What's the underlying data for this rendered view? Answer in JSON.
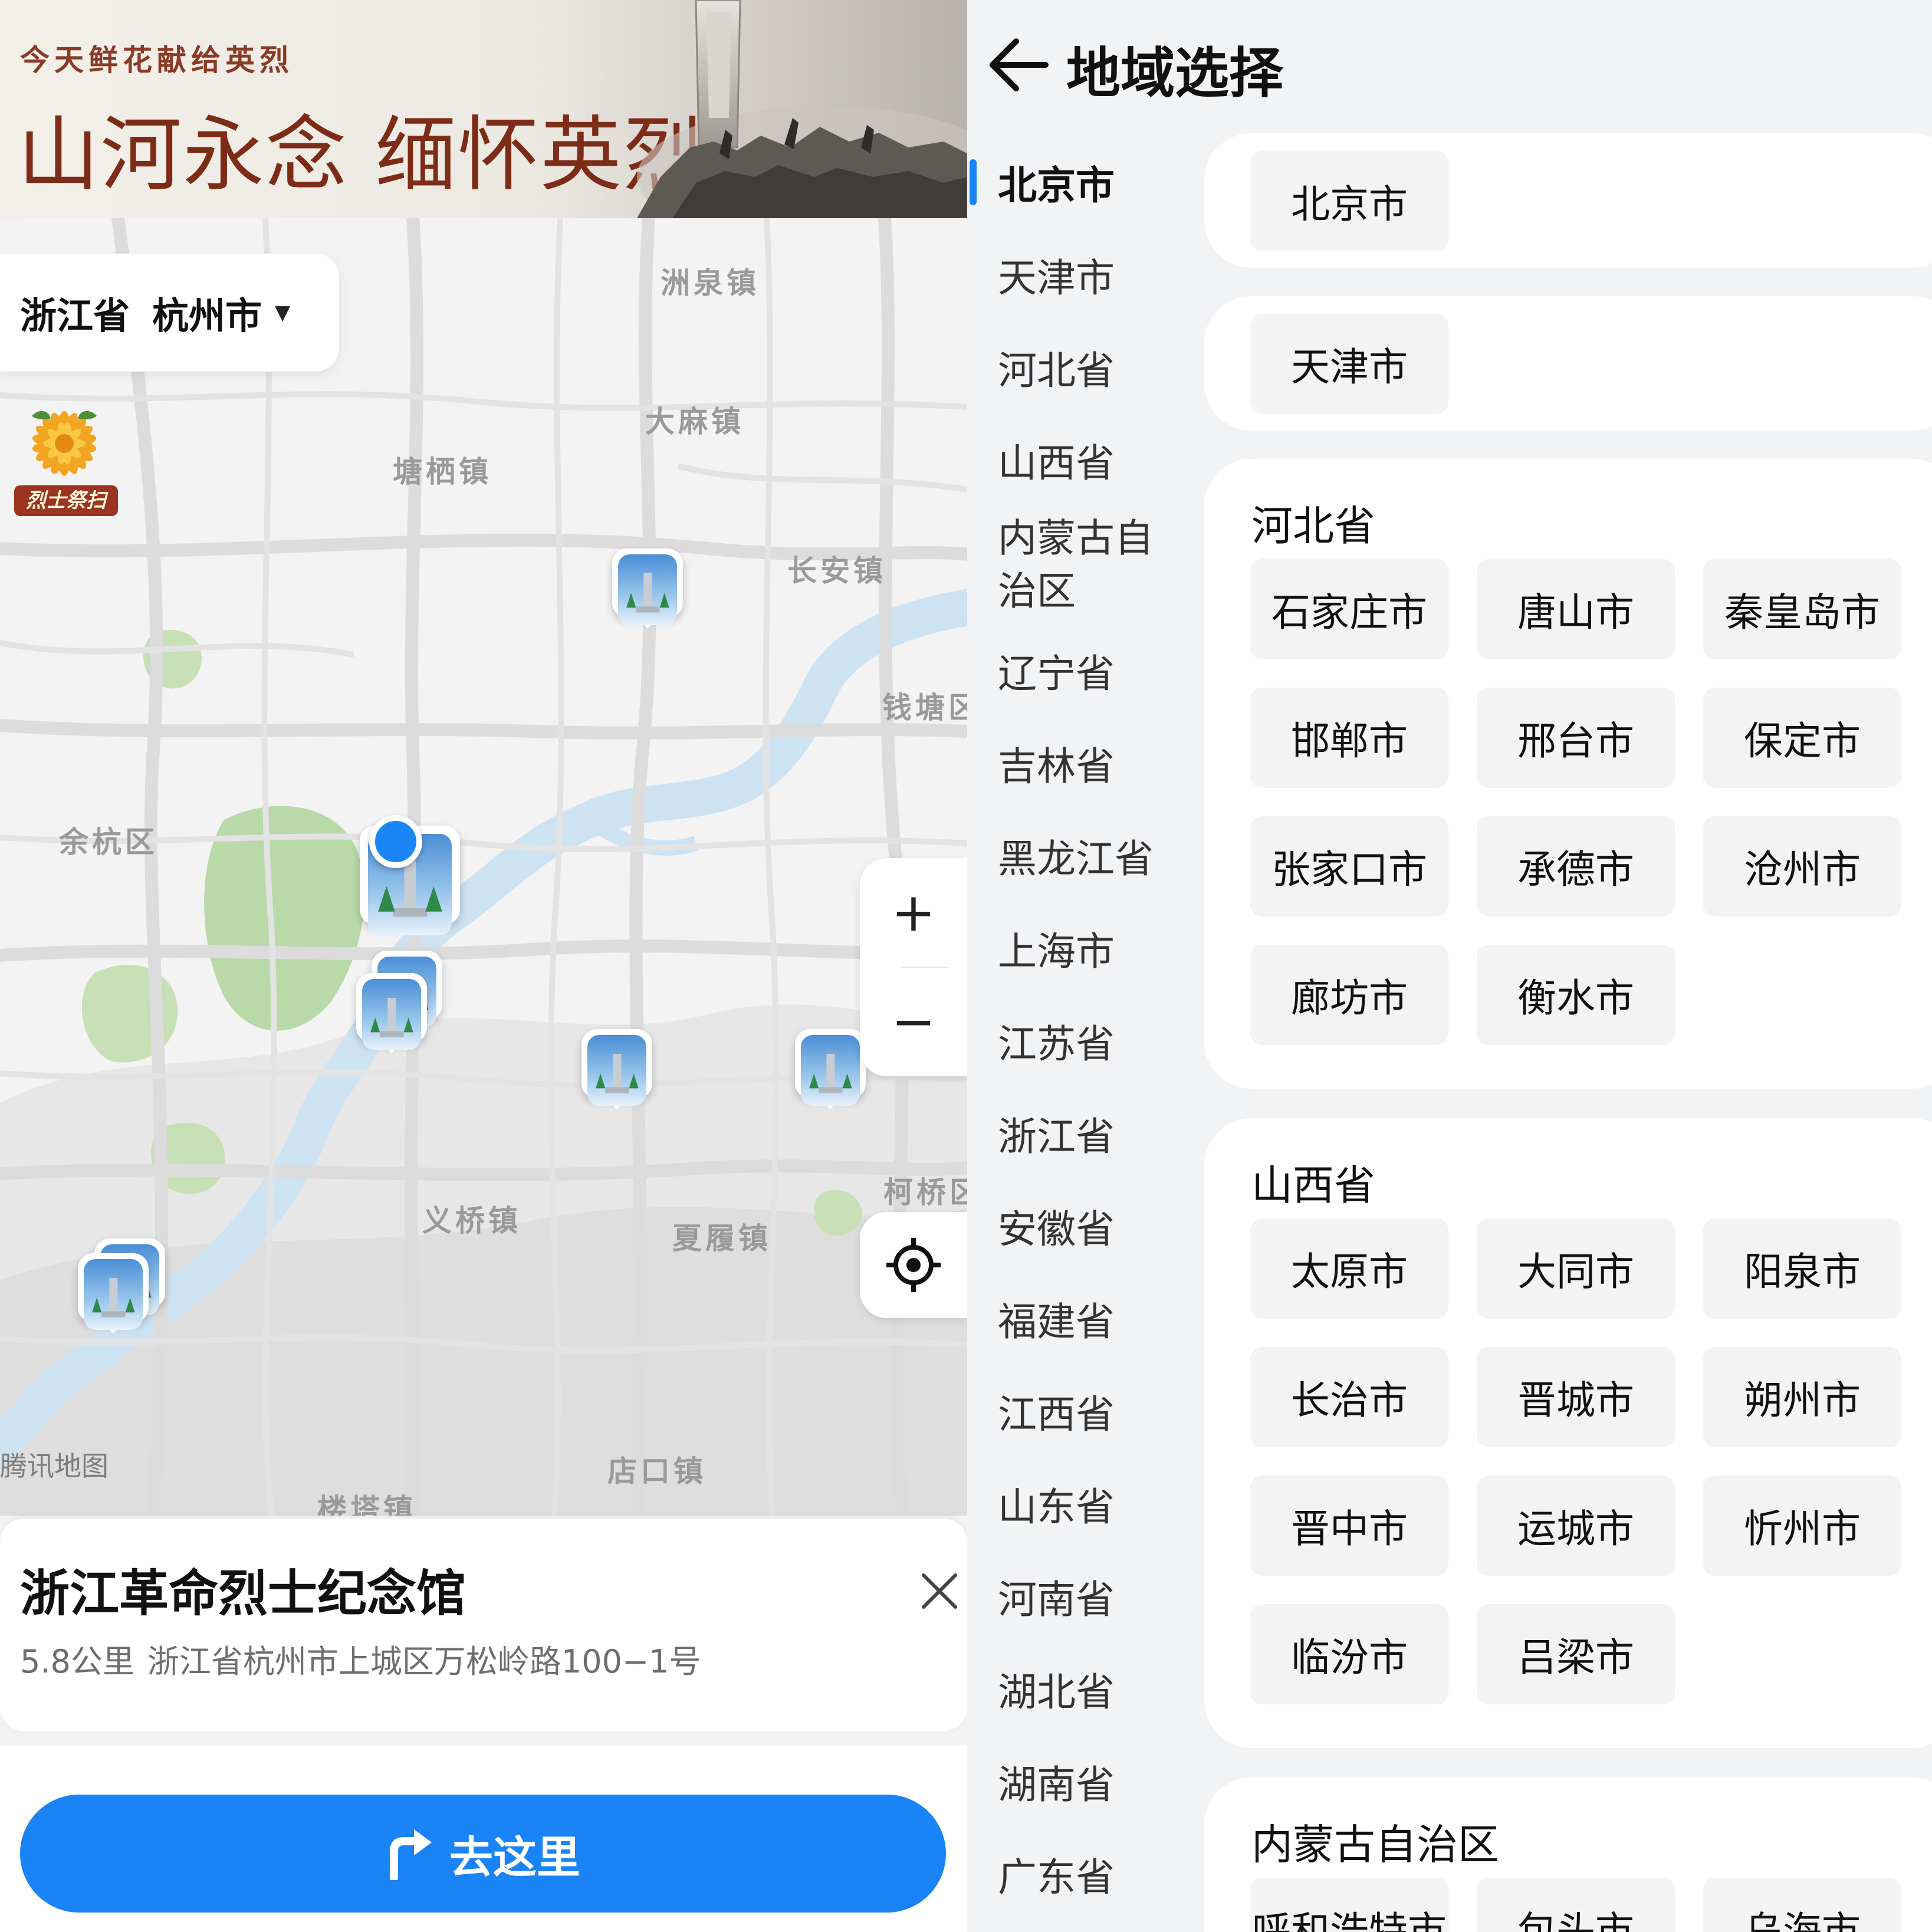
{
  "banner": {
    "subtitle": "今天鲜花献给英烈",
    "title": "山河永念 缅怀英烈"
  },
  "region_select": {
    "province": "浙江省",
    "city": "杭州市",
    "caret": "▼"
  },
  "flower_badge": {
    "label": "烈士祭扫",
    "icon": "chrysanthemum-icon"
  },
  "map": {
    "places": [
      "洲泉镇",
      "大麻镇",
      "塘栖镇",
      "长安镇",
      "钱塘区",
      "余杭区",
      "义桥镇",
      "夏履镇",
      "柯桥区",
      "楼塔镇",
      "店口镇"
    ],
    "attribution": "腾讯地图",
    "zoom_in": "+",
    "zoom_out": "−"
  },
  "info_card": {
    "name": "浙江革命烈士纪念馆",
    "distance": "5.8公里",
    "address": "浙江省杭州市上城区万松岭路100−1号"
  },
  "go_button": {
    "label": "去这里"
  },
  "region_page": {
    "title": "地域选择",
    "provinces": [
      "北京市",
      "天津市",
      "河北省",
      "山西省",
      "内蒙古自治区",
      "辽宁省",
      "吉林省",
      "黑龙江省",
      "上海市",
      "江苏省",
      "浙江省",
      "安徽省",
      "福建省",
      "江西省",
      "山东省",
      "河南省",
      "湖北省",
      "湖南省",
      "广东省"
    ],
    "active_province": "北京市",
    "groups": [
      {
        "title": "",
        "cities": [
          "北京市"
        ]
      },
      {
        "title": "",
        "cities": [
          "天津市"
        ]
      },
      {
        "title": "河北省",
        "cities": [
          "石家庄市",
          "唐山市",
          "秦皇岛市",
          "邯郸市",
          "邢台市",
          "保定市",
          "张家口市",
          "承德市",
          "沧州市",
          "廊坊市",
          "衡水市"
        ]
      },
      {
        "title": "山西省",
        "cities": [
          "太原市",
          "大同市",
          "阳泉市",
          "长治市",
          "晋城市",
          "朔州市",
          "晋中市",
          "运城市",
          "忻州市",
          "临汾市",
          "吕梁市"
        ]
      },
      {
        "title": "内蒙古自治区",
        "cities": [
          "呼和浩特市",
          "包头市",
          "乌海市"
        ]
      }
    ]
  },
  "colors": {
    "accent": "#1a84f6",
    "banner_red": "#7d2c17",
    "badge_red": "#9b3420"
  }
}
